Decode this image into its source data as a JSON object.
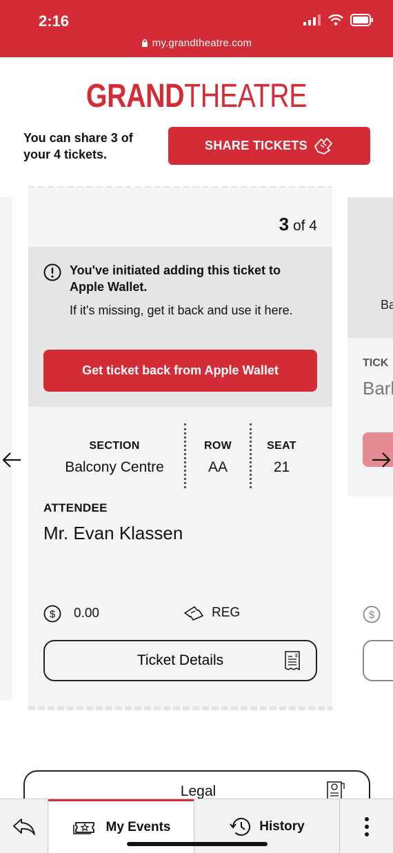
{
  "status_bar": {
    "time": "2:16",
    "url": "my.grandtheatre.com"
  },
  "logo": {
    "bold": "GRAND",
    "light": "THEATRE"
  },
  "share": {
    "text": "You can share 3 of your 4 tickets.",
    "button_label": "SHARE TICKETS"
  },
  "ticket": {
    "count_current": "3",
    "count_suffix": " of 4",
    "wallet": {
      "title": "You've initiated adding this ticket to Apple Wallet.",
      "subtitle": "If it's missing, get it back and use it here.",
      "button_label": "Get ticket back from Apple Wallet"
    },
    "section_label": "SECTION",
    "section_value": "Balcony Centre",
    "row_label": "ROW",
    "row_value": "AA",
    "seat_label": "SEAT",
    "seat_value": "21",
    "attendee_label": "ATTENDEE",
    "attendee_name": "Mr. Evan Klassen",
    "price": "0.00",
    "price_type": "REG",
    "details_button": "Ticket Details"
  },
  "next_ticket_peek": {
    "partial_text_1": "Ba",
    "partial_label": "TICK",
    "partial_value": "Barl"
  },
  "legal": {
    "label": "Legal"
  },
  "bottom_nav": {
    "my_events": "My Events",
    "history": "History"
  },
  "colors": {
    "brand": "#d42c36",
    "card": "#f4f4f4",
    "wallet_box": "#e5e5e5"
  },
  "icons": [
    "lock-icon",
    "signal-icon",
    "wifi-icon",
    "battery-icon",
    "share-hand-icon",
    "info-icon",
    "dollar-icon",
    "ticket-icon",
    "receipt-icon",
    "arrow-left-icon",
    "arrow-right-icon",
    "back-icon",
    "tickets-star-icon",
    "history-icon",
    "more-icon"
  ]
}
